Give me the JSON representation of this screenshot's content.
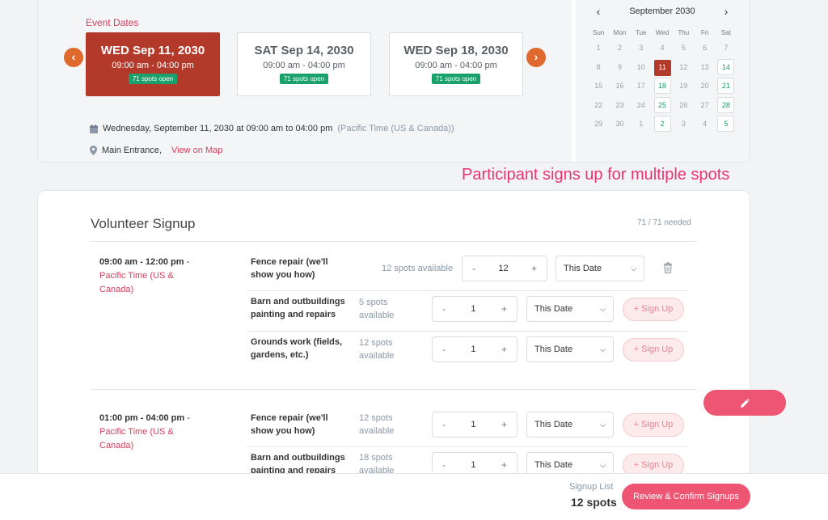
{
  "event": {
    "dates_label": "Event Dates",
    "dates": [
      {
        "title": "WED Sep 11, 2030",
        "time": "09:00 am - 04:00 pm",
        "badge": "71 spots open"
      },
      {
        "title": "SAT Sep 14, 2030",
        "time": "09:00 am - 04:00 pm",
        "badge": "71 spots open"
      },
      {
        "title": "WED Sep 18, 2030",
        "time": "09:00 am - 04:00 pm",
        "badge": "71 spots open"
      }
    ],
    "datetime_text": "Wednesday, September 11, 2030 at 09:00 am to 04:00 pm",
    "timezone_text": "(Pacific Time (US & Canada))",
    "location": "Main Entrance,",
    "map_link": "View on Map"
  },
  "calendar": {
    "month": "September 2030",
    "prev": "‹",
    "next": "›",
    "weekdays": [
      "Sun",
      "Mon",
      "Tue",
      "Wed",
      "Thu",
      "Fri",
      "Sat"
    ],
    "days": [
      "1",
      "2",
      "3",
      "4",
      "5",
      "6",
      "7",
      "8",
      "9",
      "10",
      "11",
      "12",
      "13",
      "14",
      "15",
      "16",
      "17",
      "18",
      "19",
      "20",
      "21",
      "22",
      "23",
      "24",
      "25",
      "26",
      "27",
      "28",
      "29",
      "30",
      "1",
      "2",
      "3",
      "4",
      "5"
    ],
    "selected_day": "11",
    "available_days": [
      "14",
      "18",
      "21",
      "25",
      "28",
      "2",
      "5"
    ]
  },
  "annotation": "Participant signs up for multiple spots",
  "signup": {
    "title": "Volunteer Signup",
    "needed": "71 / 71 needed",
    "slots": [
      {
        "time": "09:00 am - 12:00 pm",
        "sep": "-",
        "tz": "Pacific Time (US & Canada)",
        "tasks": [
          {
            "name": "Fence repair (we'll show you how)",
            "spots": "12 spots available",
            "qty": "12",
            "date": "This Date"
          },
          {
            "name": "Barn and outbuildings painting and repairs",
            "spots": "5 spots available",
            "qty": "1",
            "date": "This Date",
            "button": "+ Sign Up"
          },
          {
            "name": "Grounds work (fields, gardens, etc.)",
            "spots": "12 spots available",
            "qty": "1",
            "date": "This Date",
            "button": "+ Sign Up"
          }
        ]
      },
      {
        "time": "01:00 pm - 04:00 pm",
        "sep": "-",
        "tz": "Pacific Time (US & Canada)",
        "tasks": [
          {
            "name": "Fence repair (we'll show you how)",
            "spots": "12 spots available",
            "qty": "1",
            "date": "This Date",
            "button": "+ Sign Up"
          },
          {
            "name": "Barn and outbuildings painting and repairs",
            "spots": "18 spots available",
            "qty": "1",
            "date": "This Date",
            "button": "+ Sign Up"
          }
        ]
      }
    ]
  },
  "stepper": {
    "minus": "-",
    "plus": "+"
  },
  "footer": {
    "signup_list_label": "Signup List",
    "count": "12 spots",
    "confirm_button": "Review & Confirm Signups"
  },
  "icons": {
    "fab": "pencil-icon",
    "delete": "trash-icon",
    "calendar": "calendar-icon",
    "location": "map-pin-icon"
  },
  "colors": {
    "accent": "#ee5573",
    "selected_date": "#b33a2b",
    "badge": "#19a06b",
    "arrow": "#e06a2e",
    "link": "#d6405e"
  }
}
